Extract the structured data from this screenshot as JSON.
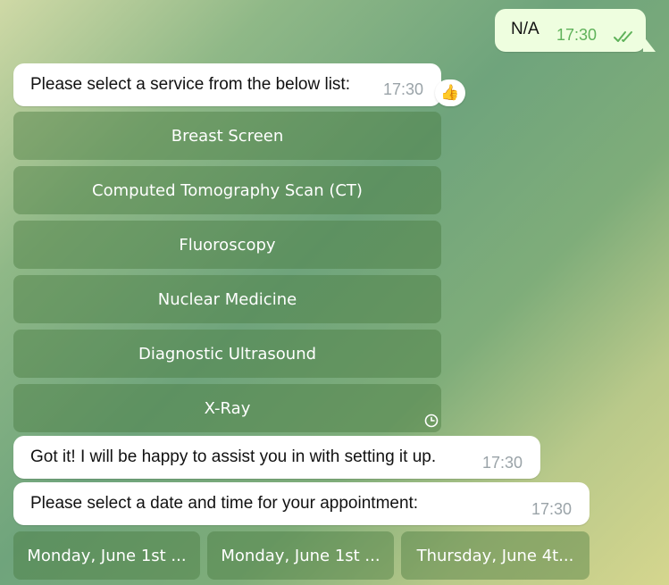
{
  "messages": {
    "outgoing": {
      "text": "N/A",
      "time": "17:30"
    },
    "select_service": {
      "text": "Please select a service from the below list:",
      "time": "17:30",
      "reaction": "👍"
    },
    "got_it": {
      "text": "Got it! I will be happy to assist you in with setting it up.",
      "time": "17:30"
    },
    "select_date": {
      "text": "Please select a date and time for your appointment:",
      "time": "17:30"
    }
  },
  "service_buttons": [
    "Breast Screen",
    "Computed Tomography Scan (CT)",
    "Fluoroscopy",
    "Nuclear Medicine",
    "Diagnostic Ultrasound",
    "X-Ray"
  ],
  "date_buttons": [
    "Monday, June 1st ...",
    "Monday, June 1st ...",
    "Thursday, June 4t..."
  ],
  "icons": {
    "read_status": "double-check-icon",
    "pending": "clock-icon",
    "reaction": "thumbs-up-icon"
  },
  "colors": {
    "outgoing_bubble": "#eefedf",
    "incoming_bubble": "#ffffff",
    "timestamp_outgoing": "#5fb25a",
    "timestamp_incoming": "#9aa3a8"
  }
}
